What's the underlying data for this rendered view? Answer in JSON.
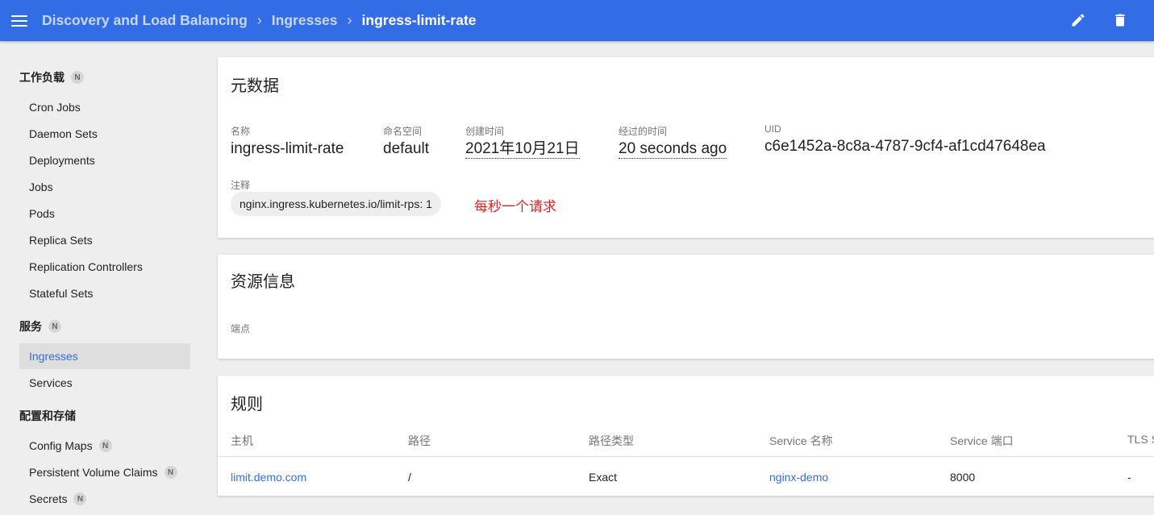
{
  "header": {
    "breadcrumbs": [
      "Discovery and Load Balancing",
      "Ingresses"
    ],
    "current": "ingress-limit-rate",
    "bar_color": "#326de6"
  },
  "sidebar": {
    "sections": [
      {
        "label": "工作负载",
        "badge": "N"
      },
      {
        "label": "服务",
        "badge": "N"
      },
      {
        "label": "配置和存储",
        "badge": ""
      }
    ],
    "workloads": [
      "Cron Jobs",
      "Daemon Sets",
      "Deployments",
      "Jobs",
      "Pods",
      "Replica Sets",
      "Replication Controllers",
      "Stateful Sets"
    ],
    "services": [
      "Ingresses",
      "Services"
    ],
    "config": [
      {
        "label": "Config Maps",
        "badge": "N"
      },
      {
        "label": "Persistent Volume Claims",
        "badge": "N"
      },
      {
        "label": "Secrets",
        "badge": "N"
      }
    ],
    "active_item": "Ingresses"
  },
  "metadata": {
    "title": "元数据",
    "name_label": "名称",
    "name": "ingress-limit-rate",
    "namespace_label": "命名空间",
    "namespace": "default",
    "created_label": "创建时间",
    "created": "2021年10月21日",
    "age_label": "经过的时间",
    "age": "20 seconds ago",
    "uid_label": "UID",
    "uid": "c6e1452a-8c8a-4787-9cf4-af1cd47648ea",
    "annotations_label": "注释",
    "annotation": "nginx.ingress.kubernetes.io/limit-rps: 1",
    "note": "每秒一个请求",
    "note_color": "#e02020"
  },
  "resource": {
    "title": "资源信息",
    "endpoints_label": "端点"
  },
  "rules": {
    "title": "规则",
    "columns": [
      "主机",
      "路径",
      "路径类型",
      "Service 名称",
      "Service 端口",
      "TLS S"
    ],
    "rows": [
      {
        "host": "limit.demo.com",
        "path": "/",
        "path_type": "Exact",
        "service": "nginx-demo",
        "port": "8000",
        "tls": "-"
      }
    ]
  }
}
